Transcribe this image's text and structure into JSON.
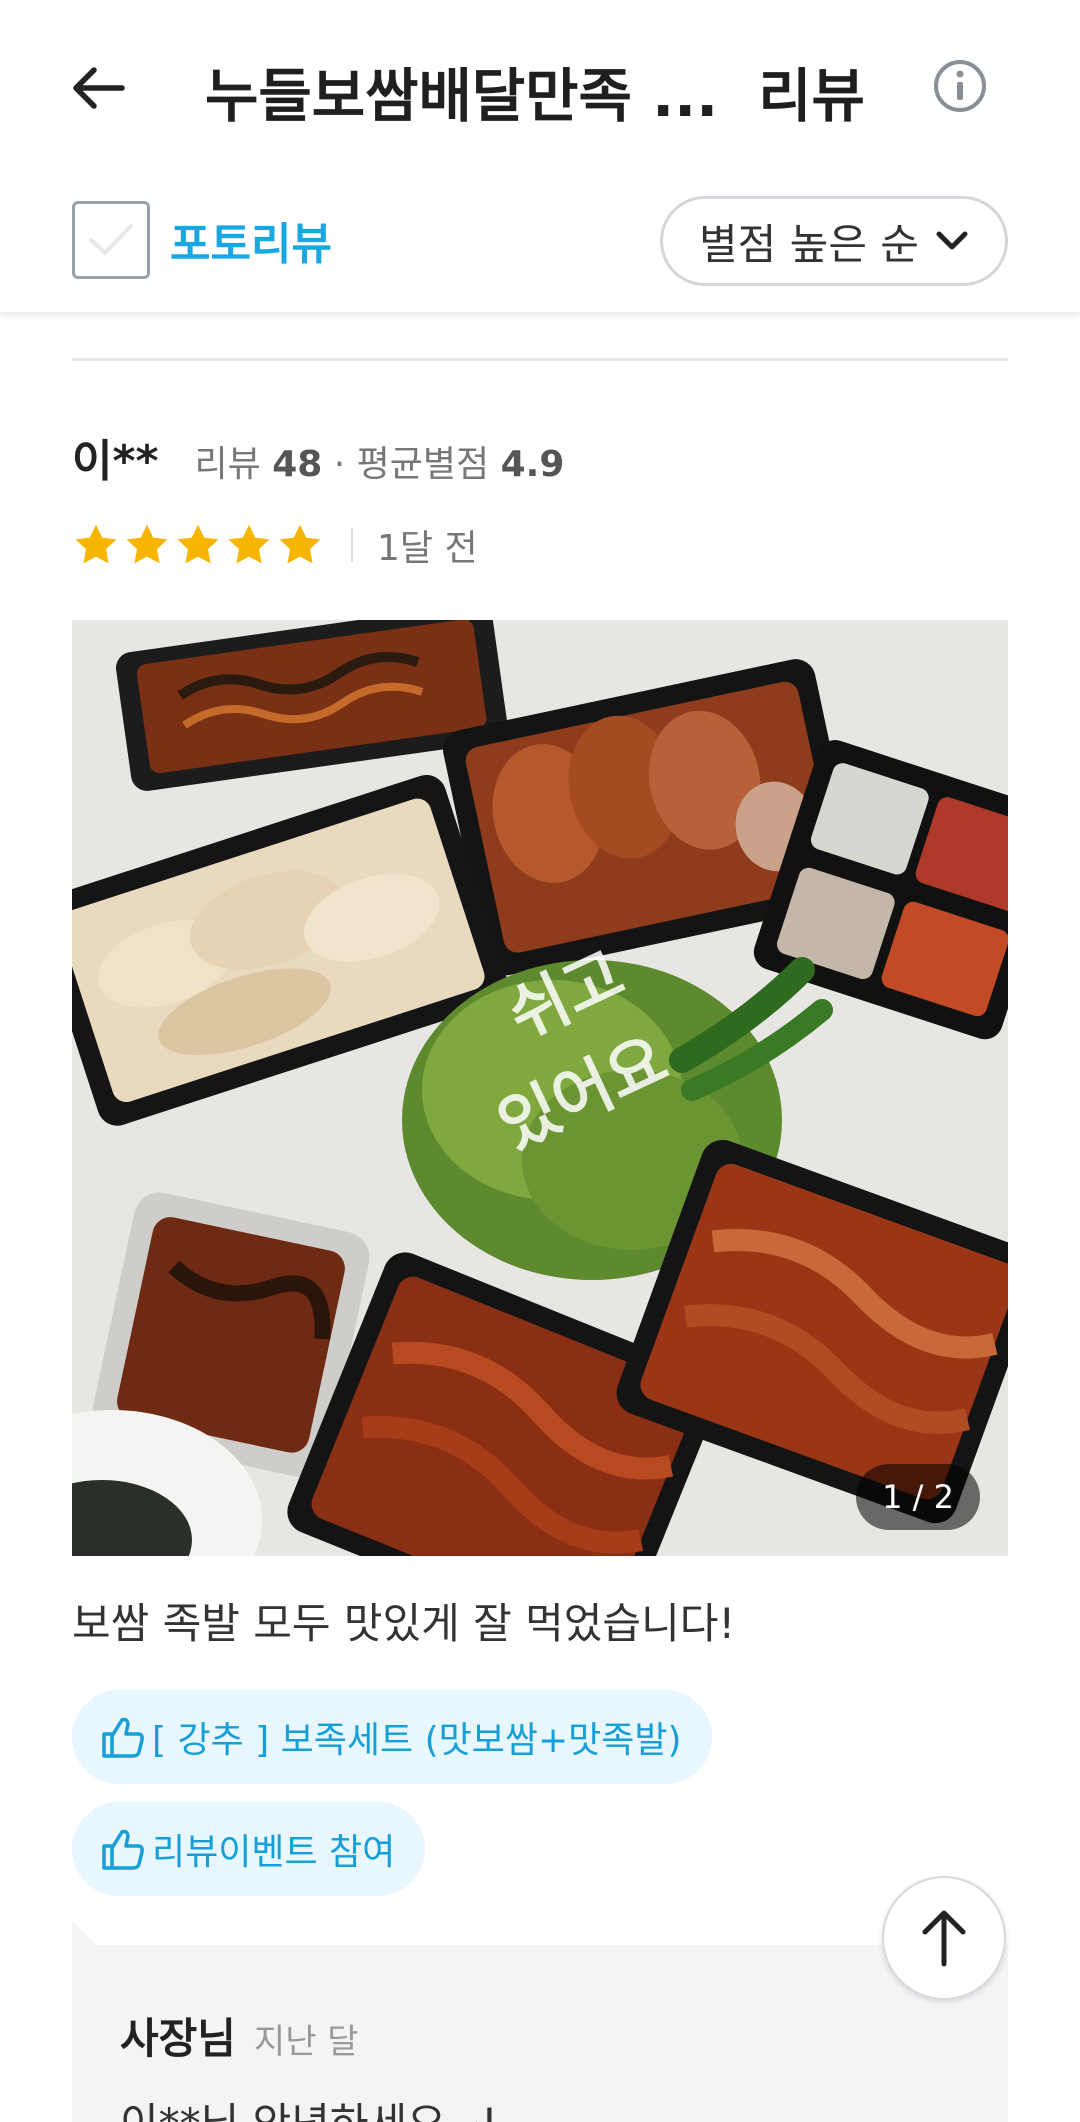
{
  "header": {
    "store_name": "누들보쌈배달만족 ...",
    "title_suffix": "리뷰"
  },
  "filters": {
    "photo_review_label": "포토리뷰",
    "photo_review_checked": false,
    "sort_label": "별점 높은 순"
  },
  "review": {
    "reviewer_name": "이**",
    "review_count_label": "리뷰",
    "review_count": "48",
    "avg_label": "평균별점",
    "avg_rating": "4.9",
    "stars": 5,
    "date": "1달 전",
    "photo_counter": "1 / 2",
    "text": "보쌈 족발 모두 맛있게 잘 먹었습니다!",
    "tags": [
      "[ 강추 ] 보족세트 (맛보쌈+맛족발)",
      "리뷰이벤트  참여"
    ]
  },
  "owner_reply": {
    "name": "사장님",
    "date": "지난 달",
    "text": "이**님 안녕하세요~!"
  },
  "colors": {
    "accent": "#18a7e0",
    "star": "#f8b500",
    "tag_bg": "#e8f6fd",
    "reply_bg": "#f3f4f6"
  },
  "icons": {
    "back": "arrow-left-icon",
    "info": "info-circle-icon",
    "sort": "chevron-down-icon",
    "tag": "thumbs-up-icon",
    "scroll_top": "arrow-up-icon"
  }
}
